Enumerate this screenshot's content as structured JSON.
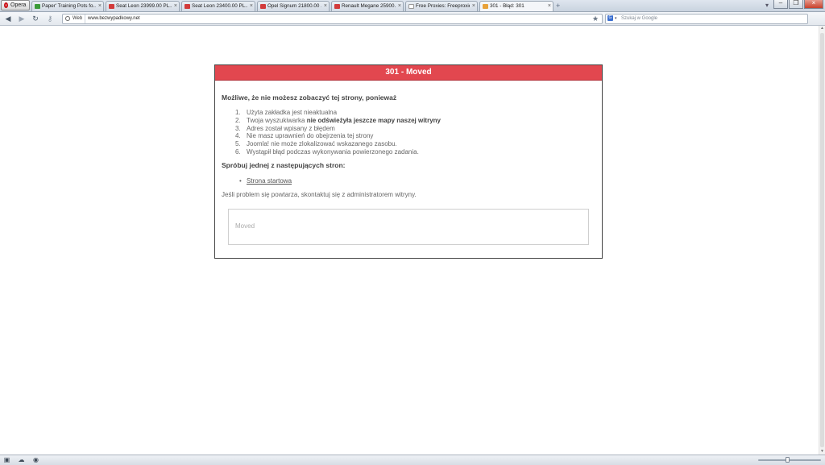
{
  "browser": {
    "menu_label": "Opera",
    "tabs": [
      {
        "title": "Paper' Training Pots fo...",
        "favicon_color": "#3a9b3a"
      },
      {
        "title": "Seat Leon 23999.00 PL...",
        "favicon_color": "#d23b3b"
      },
      {
        "title": "Seat Leon 23400.00 PL...",
        "favicon_color": "#d23b3b"
      },
      {
        "title": "Opel Signum 21800.00 ...",
        "favicon_color": "#d23b3b"
      },
      {
        "title": "Renault Megane 25900....",
        "favicon_color": "#d23b3b"
      },
      {
        "title": "Free Proxies: Freeproxie...",
        "favicon_color": "#ffffff"
      },
      {
        "title": "301 - Błąd: 301",
        "favicon_color": "#e8a23a",
        "active": true
      }
    ],
    "address": {
      "badge": "Web",
      "url": "www.bezwypadkowy.net"
    },
    "search": {
      "engine_letter": "G",
      "placeholder": "Szukaj w Google"
    }
  },
  "error_page": {
    "header": "301 - Moved",
    "lead": "Możliwe, że nie możesz zobaczyć tej strony, ponieważ",
    "reasons": [
      {
        "num": "1.",
        "text": "Użyta zakładka jest nieaktualna"
      },
      {
        "num": "2.",
        "text": "Twoja wyszukiwarka ",
        "bold": "nie odświeżyła jeszcze mapy naszej witryny"
      },
      {
        "num": "3.",
        "text": "Adres został wpisany z błędem"
      },
      {
        "num": "4.",
        "text": "Nie masz uprawnień do obejrzenia tej strony"
      },
      {
        "num": "5.",
        "text": "Joomla! nie może zlokalizować wskazanego zasobu."
      },
      {
        "num": "6.",
        "text": "Wystąpił błąd podczas wykonywania powierzonego zadania."
      }
    ],
    "try_heading": "Spróbuj jednej z następujących stron:",
    "links": [
      {
        "label": "Strona startowa"
      }
    ],
    "contact": "Jeśli problem się powtarza, skontaktuj się z administratorem witryny.",
    "message": "Moved"
  },
  "colors": {
    "header_bg": "#e2474f",
    "header_text": "#ffffff"
  }
}
